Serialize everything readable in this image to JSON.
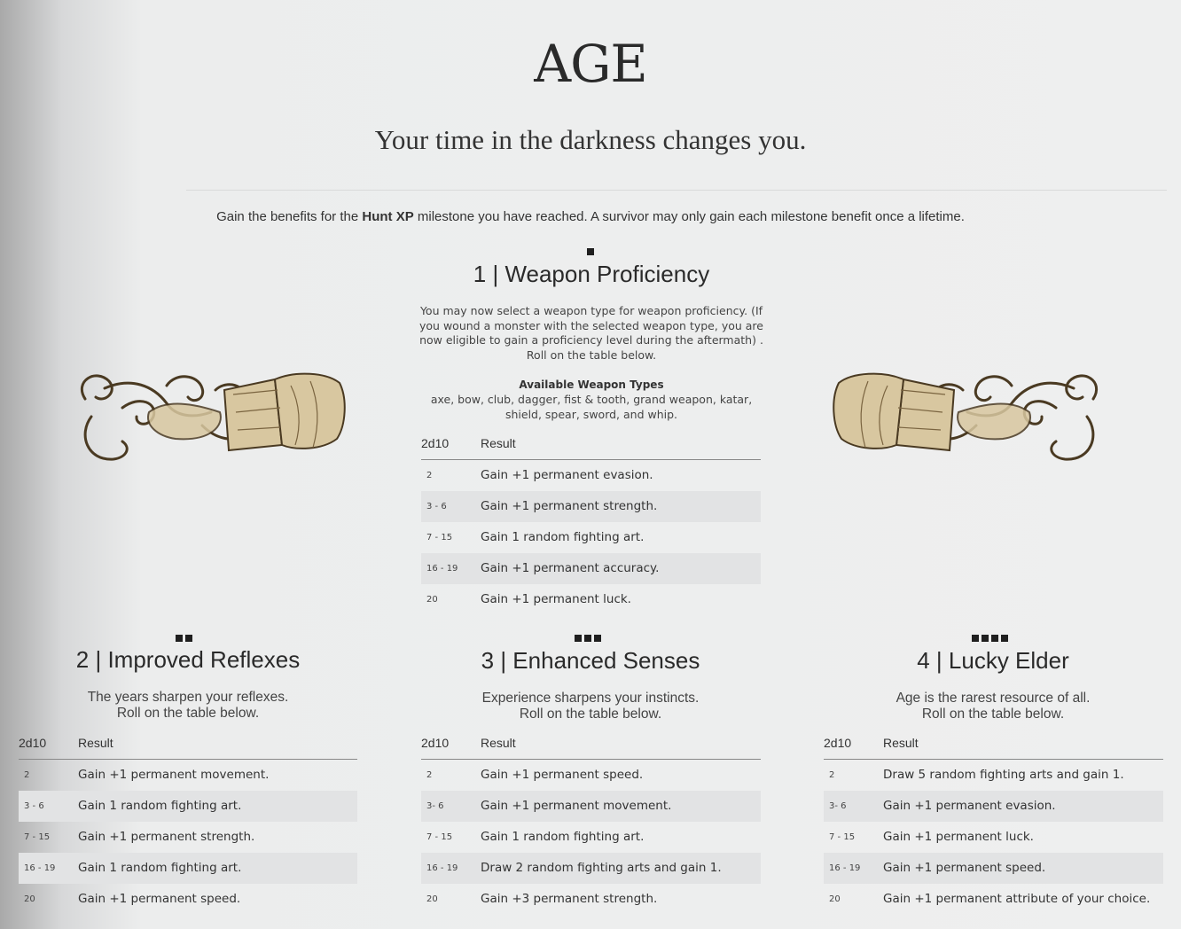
{
  "page": {
    "title": "AGE",
    "subtitle": "Your time in the darkness changes you.",
    "intro_pre": "Gain the benefits for the ",
    "intro_bold": "Hunt XP",
    "intro_post": " milestone you have reached. A survivor may only gain each milestone benefit once a lifetime."
  },
  "sections": [
    {
      "title": "1 | Weapon Proficiency",
      "pips": 1,
      "description": "You may now select a weapon type for weapon proficiency. (If you wound a monster with the selected weapon type, you are now eligible to gain a proficiency level during the aftermath) . Roll on the table below.",
      "available_heading": "Available Weapon Types",
      "available_list": "axe, bow, club, dagger, fist & tooth, grand weapon, katar, shield, spear, sword, and whip.",
      "table": {
        "col1": "2d10",
        "col2": "Result",
        "rows": [
          {
            "roll": "2",
            "result": "Gain +1 permanent evasion."
          },
          {
            "roll": "3 - 6",
            "result": "Gain +1 permanent strength."
          },
          {
            "roll": "7 - 15",
            "result": "Gain 1 random fighting art."
          },
          {
            "roll": "16 - 19",
            "result": "Gain +1 permanent accuracy."
          },
          {
            "roll": "20",
            "result": "Gain +1 permanent luck."
          }
        ]
      }
    },
    {
      "title": "2 | Improved Reflexes",
      "pips": 2,
      "line1": "The years sharpen your reflexes.",
      "line2": "Roll on the table below.",
      "table": {
        "col1": "2d10",
        "col2": "Result",
        "rows": [
          {
            "roll": "2",
            "result": "Gain +1 permanent movement."
          },
          {
            "roll": "3 - 6",
            "result": "Gain 1 random fighting art."
          },
          {
            "roll": "7 - 15",
            "result": "Gain +1 permanent strength."
          },
          {
            "roll": "16 - 19",
            "result": "Gain 1 random fighting art."
          },
          {
            "roll": "20",
            "result": "Gain +1 permanent speed."
          }
        ]
      }
    },
    {
      "title": "3 | Enhanced Senses",
      "pips": 3,
      "line1": "Experience sharpens your instincts.",
      "line2": "Roll on the table below.",
      "table": {
        "col1": "2d10",
        "col2": "Result",
        "rows": [
          {
            "roll": "2",
            "result": "Gain +1 permanent speed."
          },
          {
            "roll": "3- 6",
            "result": "Gain +1 permanent movement."
          },
          {
            "roll": "7 - 15",
            "result": "Gain 1 random fighting art."
          },
          {
            "roll": "16 - 19",
            "result": "Draw 2 random fighting arts and gain 1."
          },
          {
            "roll": "20",
            "result": "Gain +3 permanent strength."
          }
        ]
      }
    },
    {
      "title": "4 | Lucky Elder",
      "pips": 4,
      "line1": "Age is the rarest resource of all.",
      "line2": "Roll on the table below.",
      "table": {
        "col1": "2d10",
        "col2": "Result",
        "rows": [
          {
            "roll": "2",
            "result": "Draw 5 random fighting arts and gain 1."
          },
          {
            "roll": "3- 6",
            "result": "Gain +1 permanent evasion."
          },
          {
            "roll": "7 - 15",
            "result": "Gain +1 permanent luck."
          },
          {
            "roll": "16 - 19",
            "result": "Gain +1 permanent speed."
          },
          {
            "roll": "20",
            "result": "Gain +1 permanent attribute of your choice."
          }
        ]
      }
    }
  ],
  "ornaments": {
    "left": "wrapped-fist-flourish",
    "right": "wrapped-fist-flourish"
  },
  "colors": {
    "ornament_fill": "#d8c7a0",
    "ornament_stroke": "#4a3a22",
    "row_shade": "#e2e3e4"
  }
}
